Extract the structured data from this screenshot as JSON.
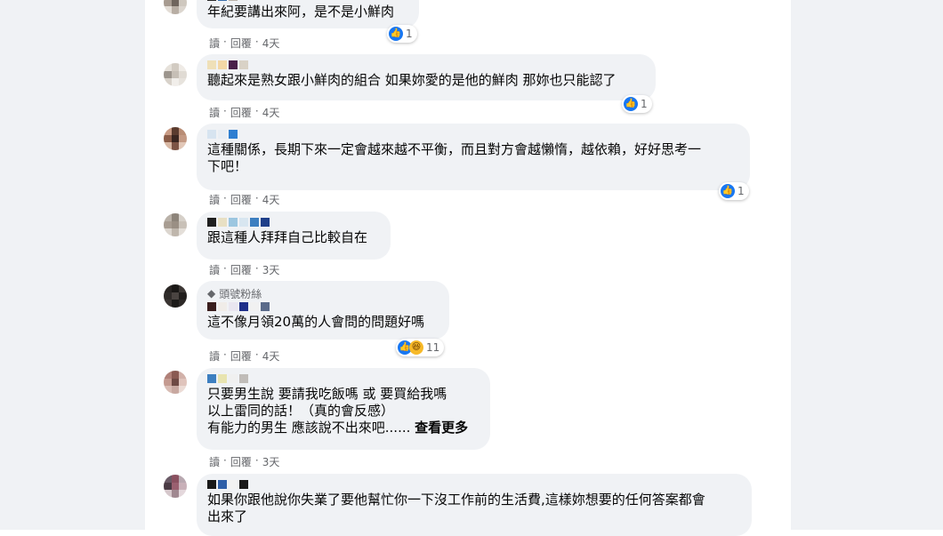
{
  "actions": {
    "read": "讀",
    "reply": "回覆",
    "dot": "·"
  },
  "comments": [
    {
      "text": "年紀要講出來阿，是不是小鮮肉",
      "time": "4天",
      "reactions": "1"
    },
    {
      "text": "聽起來是熟女跟小鮮肉的組合 如果妳愛的是他的鮮肉 那妳也只能認了",
      "time": "4天",
      "reactions": "1"
    },
    {
      "text": "這種關係，長期下來一定會越來越不平衡，而且對方會越懶惰，越依賴，好好思考一\n下吧！",
      "time": "4天",
      "reactions": "1"
    },
    {
      "text": "跟這種人拜拜自己比較自在",
      "time": "3天"
    },
    {
      "badge": "頭號粉絲",
      "text": "這不像月領20萬的人會問的問題好嗎",
      "time": "4天",
      "reactions": "11"
    },
    {
      "text": "只要男生說 要請我吃飯嗎 或 要買給我嗎\n以上雷同的話！（真的會反感）\n有能力的男生 應該說不出來吧......",
      "more": "查看更多",
      "time": "3天"
    },
    {
      "text": "如果你跟他說你失業了要他幫忙你一下沒工作前的生活費,這樣妳想要的任何答案都會\n出來了"
    }
  ],
  "icons": {
    "like": "like-icon",
    "haha": "haha-icon",
    "badge": "diamond-icon"
  },
  "colors": {
    "bubble": "#f0f2f5",
    "meta": "#65676b",
    "text": "#050505",
    "like": "#1877f2"
  }
}
